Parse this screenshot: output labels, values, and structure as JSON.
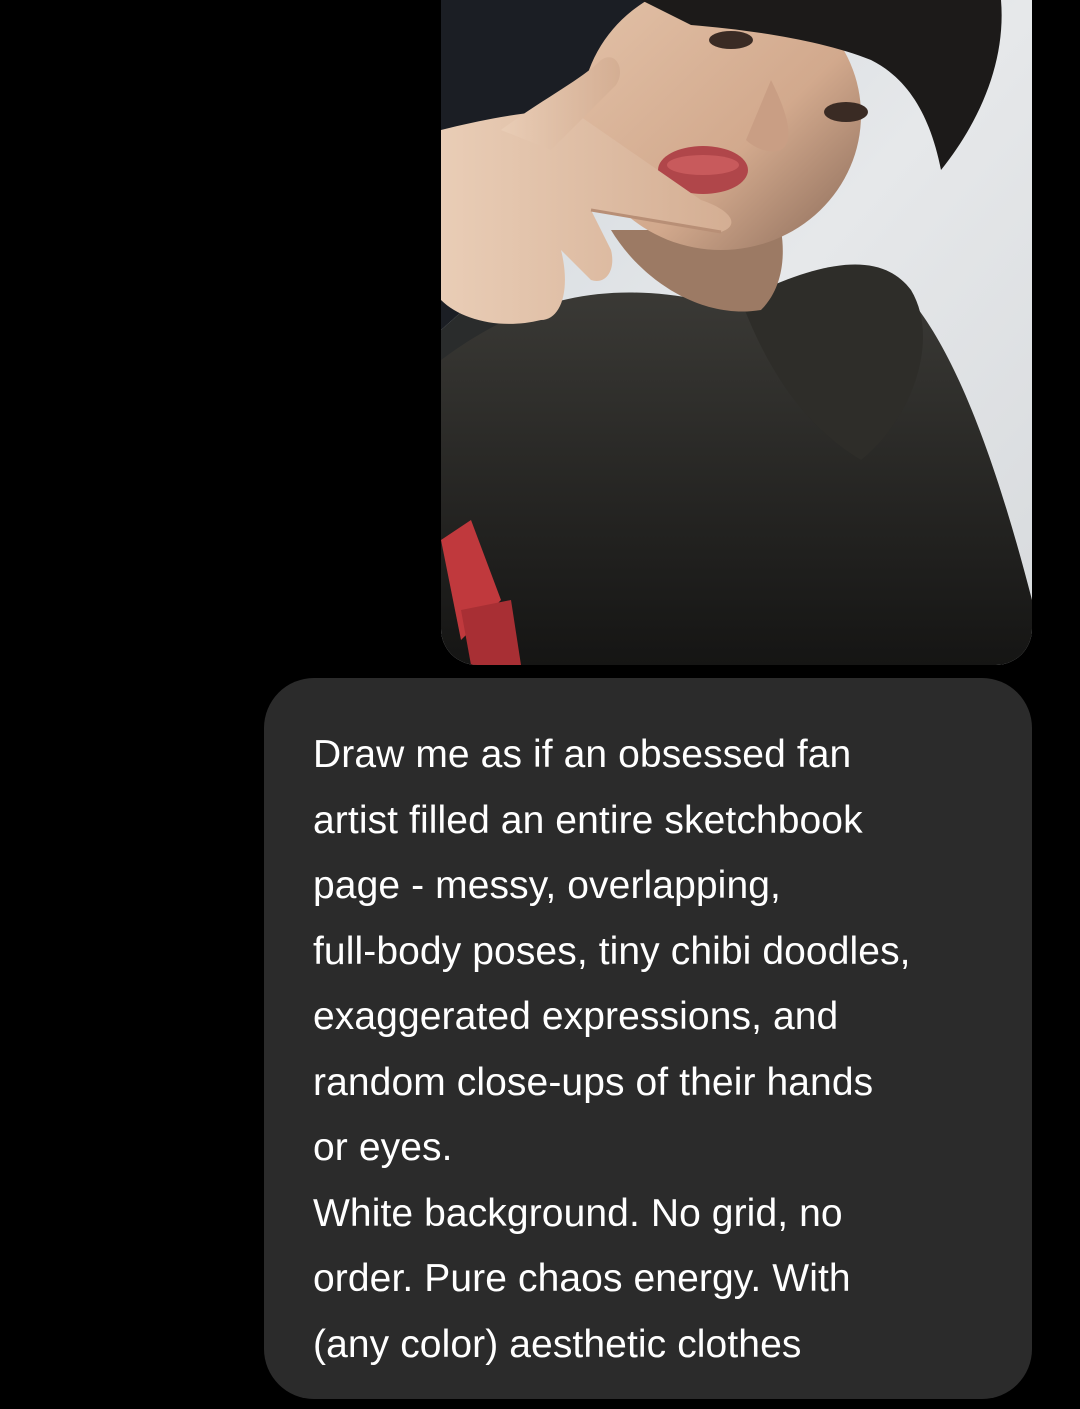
{
  "conversation": {
    "sent_photo": {
      "subject": "selfie-photo"
    },
    "message": {
      "paragraph_1": "Draw me as if an obsessed fan\nartist filled an entire sketchbook\npage - messy, overlapping,\nfull-body poses, tiny chibi doodles,\nexaggerated expressions, and\nrandom close-ups of their hands\nor eyes.",
      "paragraph_2": "White background. No grid, no\norder. Pure chaos energy. With\n(any color) aesthetic clothes"
    }
  },
  "colors": {
    "background": "#000000",
    "bubble": "#2b2b2b",
    "text": "#ffffff"
  }
}
